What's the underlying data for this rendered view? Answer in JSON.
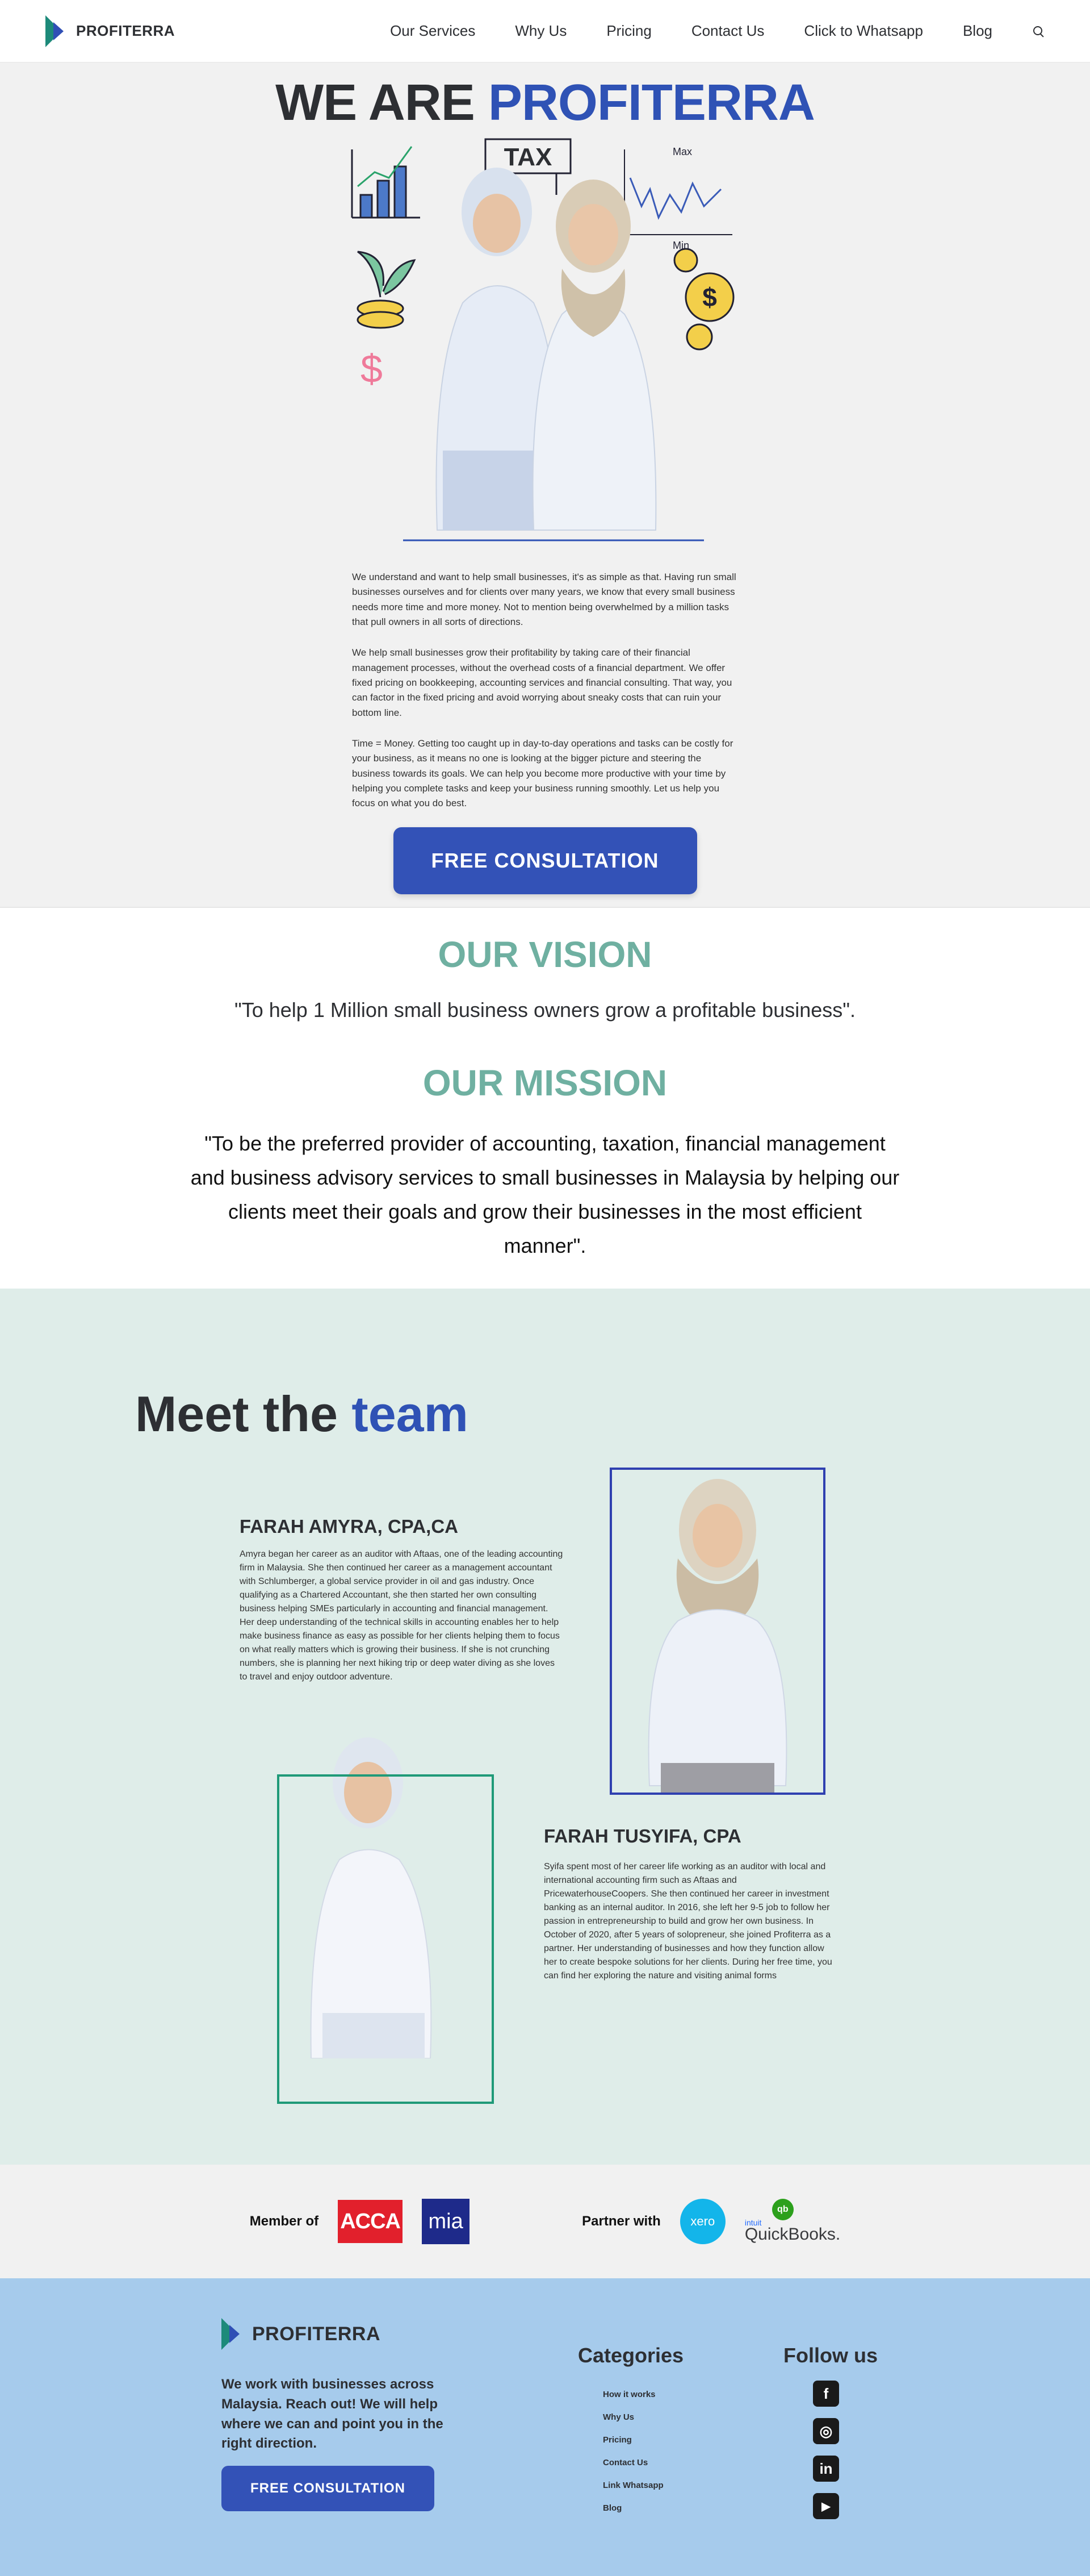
{
  "header": {
    "logo_text": "PROFITERRA",
    "nav": [
      "Our Services",
      "Why Us",
      "Pricing",
      "Contact Us",
      "Click to Whatsapp",
      "Blog"
    ]
  },
  "hero": {
    "title_part1": "WE ARE ",
    "title_part2": "PROFITERRA",
    "art_labels": {
      "tax": "TAX",
      "max": "Max",
      "min": "Min",
      "dollar": "$"
    },
    "paragraphs": [
      "We understand and want to help small businesses, it's as simple as that. Having run small businesses ourselves and for clients over many years, we know that every small business needs more time and more money. Not to mention being overwhelmed by a million tasks that pull owners in all sorts of directions.",
      "We help small businesses grow their profitability by taking care of their financial management processes, without the overhead costs of a financial department. We offer fixed pricing on bookkeeping, accounting services and financial consulting. That way, you can factor in the fixed pricing and avoid worrying about sneaky costs that can ruin your bottom line.",
      "Time = Money. Getting too caught up in day-to-day operations and tasks can be costly for your business, as it means no one is looking at the bigger picture and steering the business towards its goals. We can help you become more productive with your time by helping you complete tasks and keep your business running smoothly. Let us help you focus on what you do best."
    ],
    "cta": "FREE CONSULTATION"
  },
  "vision": {
    "title": "OUR VISION",
    "text": "\"To help 1 Million small business owners grow a profitable business\"."
  },
  "mission": {
    "title": "OUR MISSION",
    "text": "\"To be the preferred provider of accounting, taxation, financial management and business advisory services to small businesses in Malaysia by helping our clients meet their goals and grow their businesses in the most efficient manner\"."
  },
  "team": {
    "title_part1": "Meet the ",
    "title_part2": "team",
    "members": [
      {
        "name": "FARAH AMYRA, CPA,CA",
        "bio": "Amyra began her career as an auditor with Aftaas, one of the leading accounting firm in Malaysia. She then continued her career as a management accountant with Schlumberger, a global service provider in oil and gas industry. Once qualifying as a Chartered Accountant, she then started her own consulting business helping SMEs particularly in accounting and financial management. Her deep understanding of the technical skills in accounting enables her to help make business finance as easy as possible for her clients helping them to focus on what really matters which is growing their business. If she is not crunching numbers, she is planning her next hiking trip or deep water diving as she loves to travel and enjoy outdoor adventure."
      },
      {
        "name": "FARAH TUSYIFA, CPA",
        "bio": "Syifa spent most of her career life working as an auditor with local and international accounting firm such as Aftaas and PricewaterhouseCoopers. She then continued her career in investment banking as an internal auditor. In 2016, she left her 9-5 job to follow her passion in entrepreneurship to build and grow her own business. In October of 2020, after 5 years of solopreneur, she joined Profiterra as a partner. Her understanding of businesses and how they function allow her to create bespoke solutions for her clients. During her free time, you can find her exploring the nature and visiting animal forms"
      }
    ]
  },
  "partners": {
    "member_label": "Member of",
    "acca": "ACCA",
    "mia": "mia",
    "partner_label": "Partner with",
    "xero": "xero",
    "qb_badge": "qb",
    "qb_intuit": "intuit",
    "qb_name": "QuickBooks."
  },
  "footer": {
    "logo_text": "PROFITERRA",
    "tagline": "We work with businesses across Malaysia. Reach out! We will help where we can and point you in the right direction.",
    "cta": "FREE CONSULTATION",
    "categories_title": "Categories",
    "categories": [
      "How it works",
      "Why Us",
      "Pricing",
      "Contact Us",
      "Link Whatsapp",
      "Blog"
    ],
    "follow_title": "Follow us",
    "social": [
      {
        "icon": "facebook-icon",
        "glyph": "f"
      },
      {
        "icon": "instagram-icon",
        "glyph": "◎"
      },
      {
        "icon": "linkedin-icon",
        "glyph": "in"
      },
      {
        "icon": "youtube-icon",
        "glyph": "▶"
      }
    ]
  },
  "colors": {
    "accent_blue": "#2f52b5",
    "teal_heading": "#6fb0a1",
    "team_bg": "#dfede9",
    "footer_bg": "#a6cbec"
  }
}
